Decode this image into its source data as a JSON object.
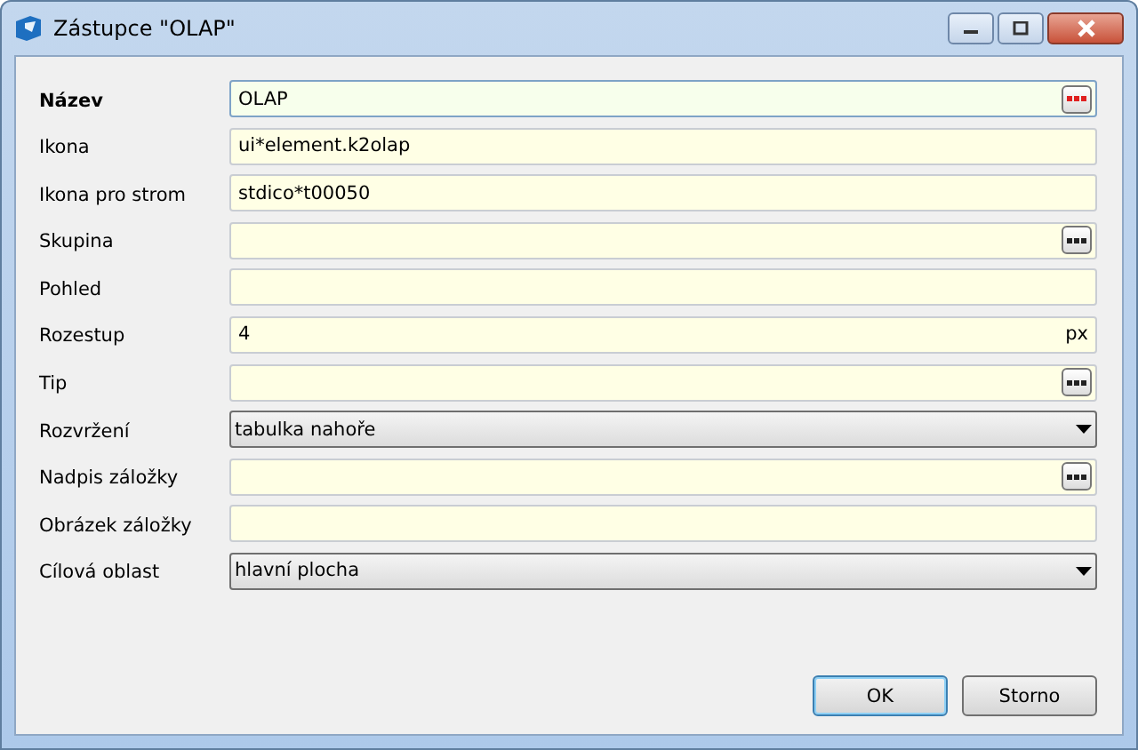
{
  "window": {
    "title": "Zástupce \"OLAP\""
  },
  "fields": [
    {
      "label": "Název",
      "kind": "text",
      "value": "OLAP",
      "focused": true,
      "ellipsis": true
    },
    {
      "label": "Ikona",
      "kind": "text",
      "value": "ui*element.k2olap",
      "focused": false,
      "ellipsis": false
    },
    {
      "label": "Ikona pro strom",
      "kind": "text",
      "value": "stdico*t00050",
      "focused": false,
      "ellipsis": false
    },
    {
      "label": "Skupina",
      "kind": "text",
      "focused": false,
      "ellipsis": true
    },
    {
      "label": "Pohled",
      "kind": "text",
      "focused": false,
      "ellipsis": false
    },
    {
      "label": "Rozestup",
      "kind": "text",
      "value": "4",
      "suffix": "px",
      "focused": false,
      "ellipsis": false
    },
    {
      "label": "Tip",
      "kind": "text",
      "focused": false,
      "ellipsis": true
    },
    {
      "label": "Rozvržení",
      "kind": "dropdown",
      "value": "tabulka nahoře"
    },
    {
      "label": "Nadpis záložky",
      "kind": "text",
      "focused": false,
      "ellipsis": true
    },
    {
      "label": "Obrázek záložky",
      "kind": "text",
      "focused": false,
      "ellipsis": false
    },
    {
      "label": "Cílová oblast",
      "kind": "dropdown",
      "value": "hlavní plocha"
    }
  ],
  "buttons": [
    {
      "label": "OK",
      "default": true
    },
    {
      "label": "Storno",
      "default": false
    }
  ]
}
